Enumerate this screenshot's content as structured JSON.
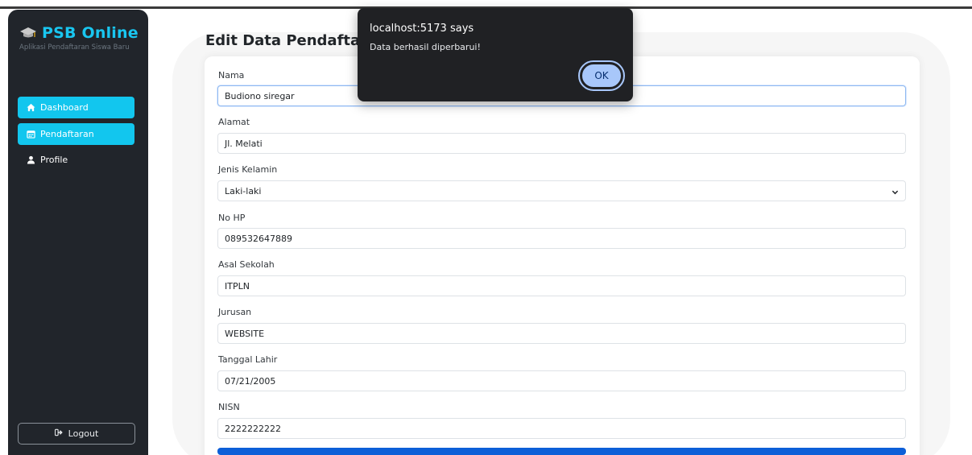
{
  "sidebar": {
    "brand_title": "PSB Online",
    "brand_subtitle": "Aplikasi Pendaftaran Siswa Baru",
    "brand_icon": "graduation-cap-icon",
    "items": [
      {
        "label": "Dashboard",
        "icon": "home-icon",
        "active": true
      },
      {
        "label": "Pendaftaran",
        "icon": "calendar-icon",
        "active": true
      },
      {
        "label": "Profile",
        "icon": "user-icon",
        "active": false
      }
    ],
    "logout_label": "Logout",
    "logout_icon": "sign-out-icon"
  },
  "main": {
    "title": "Edit Data Pendaftar",
    "fields": [
      {
        "label": "Nama",
        "value": "Budiono siregar"
      },
      {
        "label": "Alamat",
        "value": "Jl. Melati"
      },
      {
        "label": "Jenis Kelamin",
        "value": "Laki-laki"
      },
      {
        "label": "No HP",
        "value": "089532647889"
      },
      {
        "label": "Asal Sekolah",
        "value": "ITPLN"
      },
      {
        "label": "Jurusan",
        "value": "WEBSITE"
      },
      {
        "label": "Tanggal Lahir",
        "value": "07/21/2005"
      },
      {
        "label": "NISN",
        "value": "2222222222"
      }
    ]
  },
  "dialog": {
    "title": "localhost:5173 says",
    "message": "Data berhasil diperbarui!",
    "ok_label": "OK"
  },
  "colors": {
    "sidebar_bg": "#21252b",
    "accent": "#12c6ee",
    "brand": "#19c6f0",
    "submit": "#0d5fd8",
    "dialog_bg": "#202124",
    "dialog_button": "#a8c7fa"
  }
}
